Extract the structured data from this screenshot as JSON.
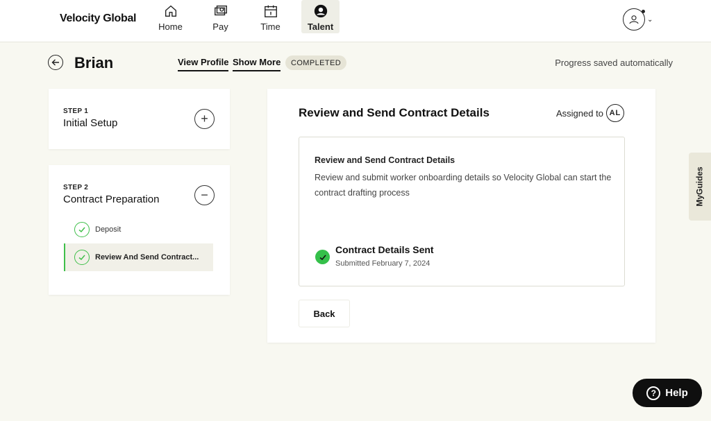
{
  "header": {
    "brand": "Velocity Global",
    "nav": [
      {
        "label": "Home",
        "icon": "home-icon"
      },
      {
        "label": "Pay",
        "icon": "pay-icon"
      },
      {
        "label": "Time",
        "icon": "calendar-icon"
      },
      {
        "label": "Talent",
        "icon": "talent-icon",
        "active": true
      }
    ],
    "avatar_icon": "user-icon"
  },
  "subheader": {
    "name": "Brian",
    "view_profile": "View Profile",
    "show_more": "Show More",
    "status": "COMPLETED",
    "saved_note": "Progress saved automatically"
  },
  "steps": [
    {
      "number": "STEP 1",
      "title": "Initial Setup",
      "toggle": "+"
    },
    {
      "number": "STEP 2",
      "title": "Contract Preparation",
      "toggle": "−",
      "items": [
        {
          "label": "Deposit"
        },
        {
          "label": "Review And Send Contract..."
        }
      ]
    }
  ],
  "main": {
    "title": "Review and Send Contract Details",
    "assigned_label": "Assigned to",
    "assigned_initials": "AL",
    "box_title": "Review and Send Contract Details",
    "box_desc": "Review and submit worker onboarding details so Velocity Global can start the contract drafting process",
    "sent_title": "Contract Details Sent",
    "sent_sub": "Submitted February 7, 2024",
    "back_label": "Back"
  },
  "side_tab": "MyGuides",
  "help_label": "Help",
  "colors": {
    "accent_green": "#35c04a",
    "background": "#f8f8f1",
    "badge": "#e6e4d6"
  }
}
